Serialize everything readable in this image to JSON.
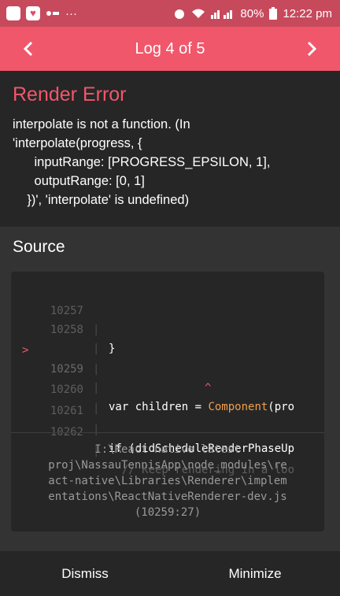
{
  "status_bar": {
    "left_dots": "···",
    "battery": "80%",
    "time": "12:22 pm"
  },
  "toolbar": {
    "title": "Log 4 of 5",
    "prev_icon": "chevron-left-icon",
    "next_icon": "chevron-right-icon"
  },
  "error": {
    "title": "Render Error",
    "message": "interpolate is not a function. (In\n'interpolate(progress, {\n      inputRange: [PROGRESS_EPSILON, 1],\n      outputRange: [0, 1]\n    })', 'interpolate' is undefined)"
  },
  "source": {
    "title": "Source",
    "lines": [
      {
        "num": "10257",
        "code": "}",
        "active": false
      },
      {
        "num": "10258",
        "code": "",
        "active": false
      },
      {
        "num": "10259",
        "code_pre": "var children = ",
        "code_fn": "Component",
        "code_post": "(pro",
        "active": true
      },
      {
        "num": "",
        "code": "^",
        "active": false
      },
      {
        "num": "10260",
        "code": "",
        "active": false
      },
      {
        "num": "10261",
        "code": "if (didScheduleRenderPhaseUp",
        "active": false
      },
      {
        "num": "10262",
        "code": "  // Keep rendering in a loo",
        "active": false
      }
    ],
    "file_path": "I:\\React native latest\nproj\\NassauTennisApp\\node_modules\\re\nact-native\\Libraries\\Renderer\\implem\nentations\\ReactNativeRenderer-dev.js\n(10259:27)"
  },
  "footer": {
    "dismiss": "Dismiss",
    "minimize": "Minimize"
  },
  "colors": {
    "accent": "#f0576b",
    "statusbar": "#c7495c",
    "background": "#2a2a2a"
  }
}
